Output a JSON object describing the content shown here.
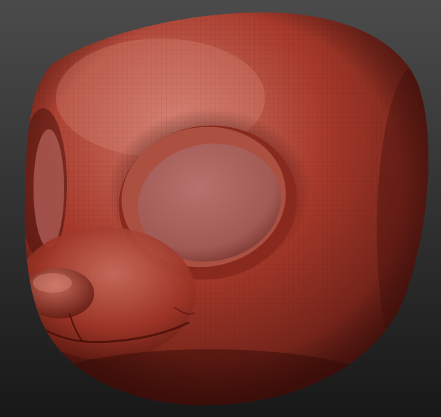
{
  "viewport": {
    "background_top": "#4b4b4b",
    "background_bottom": "#181818"
  },
  "sculpt": {
    "subject": "sculpted-animal-head",
    "material_light": "#d07a6c",
    "material_base": "#a83a2b",
    "material_shadow": "#52150f",
    "eye_socket_fill": "#b8716c",
    "wireframe_visible": true
  }
}
